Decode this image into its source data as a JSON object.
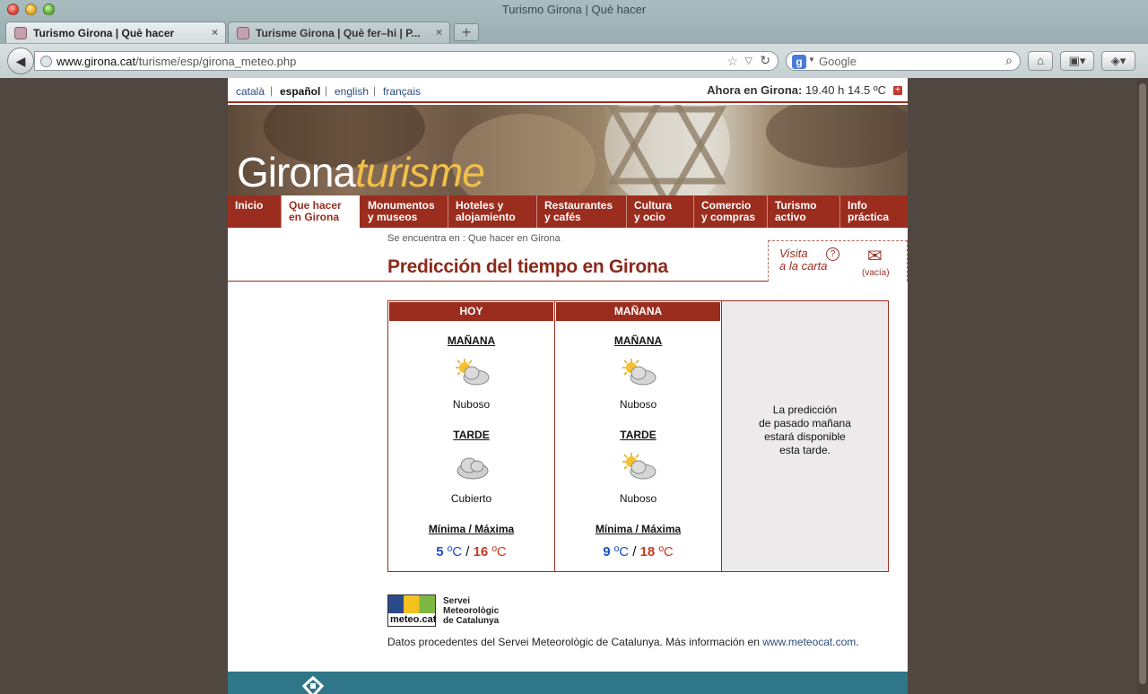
{
  "browser": {
    "window_title": "Turismo Girona | Què hacer",
    "tabs": [
      {
        "label": "Turismo Girona | Què hacer"
      },
      {
        "label": "Turisme Girona | Què fer–hi | P..."
      }
    ],
    "url_host": "www.girona.cat",
    "url_path": "/turisme/esp/girona_meteo.php",
    "search_placeholder": "Google",
    "tab_close_glyph": "×",
    "new_tab_glyph": "+"
  },
  "langbar": {
    "languages": [
      "català",
      "español",
      "english",
      "français"
    ],
    "separator": "|",
    "ahora_label": "Ahora en Girona:",
    "ahora_value": "19.40 h  14.5 ºC",
    "plus_glyph": "+"
  },
  "banner": {
    "logo_part1": "Girona",
    "logo_part2": "turisme"
  },
  "nav": [
    {
      "line1": "Inicio",
      "line2": ""
    },
    {
      "line1": "Que hacer",
      "line2": "en Girona"
    },
    {
      "line1": "Monumentos",
      "line2": "y museos"
    },
    {
      "line1": "Hoteles y",
      "line2": "alojamiento"
    },
    {
      "line1": "Restaurantes",
      "line2": "y cafés"
    },
    {
      "line1": "Cultura",
      "line2": "y ocio"
    },
    {
      "line1": "Comercio",
      "line2": "y compras"
    },
    {
      "line1": "Turismo",
      "line2": "activo"
    },
    {
      "line1": "Info",
      "line2": "práctica"
    }
  ],
  "breadcrumb": "Se encuentra en   :   Que hacer en Girona",
  "page_title": "Predicción del tiempo en Girona",
  "visita": {
    "line1": "Visita",
    "line2": "a la carta",
    "help_glyph": "?",
    "basket_status": "(vacía)"
  },
  "forecast": {
    "days": [
      {
        "header": "HOY",
        "morning_label": "MAÑANA",
        "morning_icon": "partly-cloudy-icon",
        "morning_desc": "Nuboso",
        "afternoon_label": "TARDE",
        "afternoon_icon": "cloudy-icon",
        "afternoon_desc": "Cubierto",
        "temps_label": "Mínima / Máxima",
        "min": "5",
        "max": "16"
      },
      {
        "header": "MAÑANA",
        "morning_label": "MAÑANA",
        "morning_icon": "partly-cloudy-icon",
        "morning_desc": "Nuboso",
        "afternoon_label": "TARDE",
        "afternoon_icon": "partly-cloudy-icon",
        "afternoon_desc": "Nuboso",
        "temps_label": "Mínima / Máxima",
        "min": "9",
        "max": "18"
      }
    ],
    "unit": "ºC",
    "temp_separator": "/",
    "pasado_msg_lines": [
      "La predicción",
      "de pasado mañana",
      "estará disponible",
      "esta tarde."
    ]
  },
  "meteo": {
    "brand": "meteo.cat",
    "name_lines": [
      "Servei",
      "Meteorològic",
      "de Catalunya"
    ]
  },
  "source_text": "Datos procedentes del Servei Meteorològic de Catalunya. Más información en ",
  "source_link": "www.meteocat.com",
  "source_end": ".",
  "colors": {
    "brand_red": "#9b2d1f",
    "min_blue": "#1f52c0",
    "max_red": "#c23a22",
    "footer_teal": "#2f7688"
  }
}
